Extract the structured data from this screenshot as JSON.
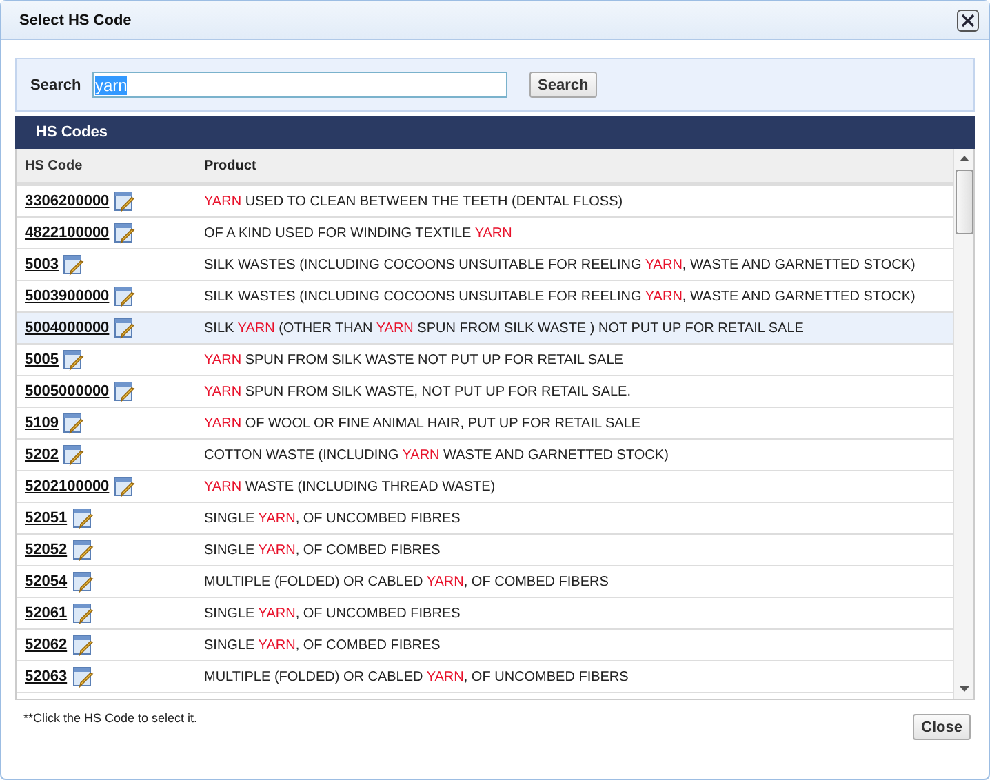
{
  "window": {
    "title": "Select HS Code"
  },
  "search": {
    "label": "Search",
    "value": "yarn",
    "value_selected": true,
    "button": "Search"
  },
  "panel": {
    "title": "HS Codes"
  },
  "table": {
    "columns": [
      "HS Code",
      "Product"
    ],
    "rows": [
      {
        "code": "3306200000",
        "selected": false,
        "product": [
          {
            "text": "YARN",
            "highlight": true
          },
          {
            "text": " USED TO CLEAN BETWEEN THE TEETH (DENTAL FLOSS)",
            "highlight": false
          }
        ]
      },
      {
        "code": "4822100000",
        "selected": false,
        "product": [
          {
            "text": "OF A KIND USED FOR WINDING TEXTILE ",
            "highlight": false
          },
          {
            "text": "YARN",
            "highlight": true
          }
        ]
      },
      {
        "code": "5003",
        "selected": false,
        "product": [
          {
            "text": "SILK WASTES (INCLUDING COCOONS UNSUITABLE FOR REELING ",
            "highlight": false
          },
          {
            "text": "YARN",
            "highlight": true
          },
          {
            "text": ", WASTE AND GARNETTED STOCK)",
            "highlight": false
          }
        ]
      },
      {
        "code": "5003900000",
        "selected": false,
        "product": [
          {
            "text": "SILK WASTES (INCLUDING COCOONS UNSUITABLE FOR REELING ",
            "highlight": false
          },
          {
            "text": "YARN",
            "highlight": true
          },
          {
            "text": ", WASTE AND GARNETTED STOCK)",
            "highlight": false
          }
        ]
      },
      {
        "code": "5004000000",
        "selected": true,
        "product": [
          {
            "text": "SILK ",
            "highlight": false
          },
          {
            "text": "YARN",
            "highlight": true
          },
          {
            "text": " (OTHER THAN ",
            "highlight": false
          },
          {
            "text": "YARN",
            "highlight": true
          },
          {
            "text": " SPUN FROM SILK WASTE ) NOT PUT UP FOR RETAIL SALE",
            "highlight": false
          }
        ]
      },
      {
        "code": "5005",
        "selected": false,
        "product": [
          {
            "text": "YARN",
            "highlight": true
          },
          {
            "text": " SPUN FROM SILK WASTE NOT PUT UP FOR RETAIL SALE",
            "highlight": false
          }
        ]
      },
      {
        "code": "5005000000",
        "selected": false,
        "product": [
          {
            "text": "YARN",
            "highlight": true
          },
          {
            "text": " SPUN FROM SILK WASTE, NOT PUT UP FOR RETAIL SALE.",
            "highlight": false
          }
        ]
      },
      {
        "code": "5109",
        "selected": false,
        "product": [
          {
            "text": "YARN",
            "highlight": true
          },
          {
            "text": " OF WOOL OR FINE ANIMAL HAIR, PUT UP FOR RETAIL SALE",
            "highlight": false
          }
        ]
      },
      {
        "code": "5202",
        "selected": false,
        "product": [
          {
            "text": "COTTON WASTE (INCLUDING ",
            "highlight": false
          },
          {
            "text": "YARN",
            "highlight": true
          },
          {
            "text": " WASTE AND GARNETTED STOCK)",
            "highlight": false
          }
        ]
      },
      {
        "code": "5202100000",
        "selected": false,
        "product": [
          {
            "text": "YARN",
            "highlight": true
          },
          {
            "text": " WASTE (INCLUDING THREAD WASTE)",
            "highlight": false
          }
        ]
      },
      {
        "code": "52051",
        "selected": false,
        "product": [
          {
            "text": "SINGLE ",
            "highlight": false
          },
          {
            "text": "YARN",
            "highlight": true
          },
          {
            "text": ", OF UNCOMBED FIBRES",
            "highlight": false
          }
        ]
      },
      {
        "code": "52052",
        "selected": false,
        "product": [
          {
            "text": "SINGLE ",
            "highlight": false
          },
          {
            "text": "YARN",
            "highlight": true
          },
          {
            "text": ", OF COMBED FIBRES",
            "highlight": false
          }
        ]
      },
      {
        "code": "52054",
        "selected": false,
        "product": [
          {
            "text": "MULTIPLE (FOLDED) OR CABLED ",
            "highlight": false
          },
          {
            "text": "YARN",
            "highlight": true
          },
          {
            "text": ", OF COMBED FIBERS",
            "highlight": false
          }
        ]
      },
      {
        "code": "52061",
        "selected": false,
        "product": [
          {
            "text": "SINGLE ",
            "highlight": false
          },
          {
            "text": "YARN",
            "highlight": true
          },
          {
            "text": ", OF UNCOMBED FIBRES",
            "highlight": false
          }
        ]
      },
      {
        "code": "52062",
        "selected": false,
        "product": [
          {
            "text": "SINGLE ",
            "highlight": false
          },
          {
            "text": "YARN",
            "highlight": true
          },
          {
            "text": ", OF COMBED FIBRES",
            "highlight": false
          }
        ]
      },
      {
        "code": "52063",
        "selected": false,
        "product": [
          {
            "text": "MULTIPLE (FOLDED) OR CABLED ",
            "highlight": false
          },
          {
            "text": "YARN",
            "highlight": true
          },
          {
            "text": ", OF UNCOMBED FIBERS",
            "highlight": false
          }
        ]
      }
    ]
  },
  "note": "**Click the HS Code to select it.",
  "buttons": [
    "Close"
  ]
}
